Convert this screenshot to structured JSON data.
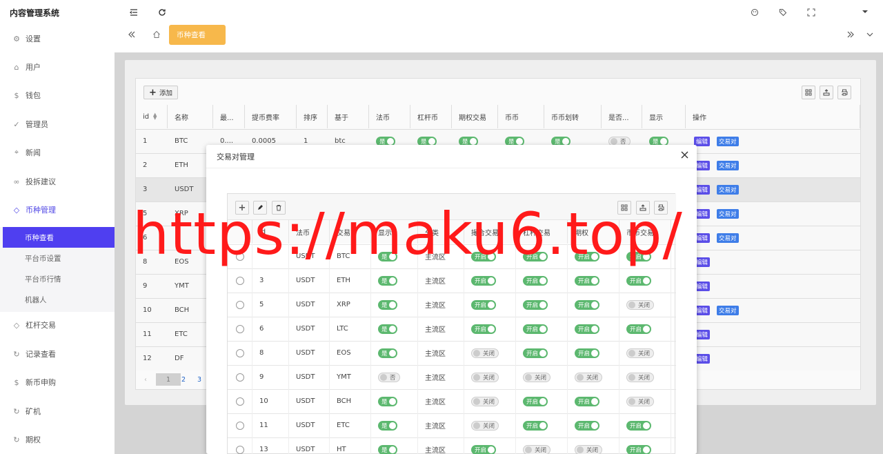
{
  "app": {
    "title": "内容管理系统"
  },
  "sidebar": {
    "items": [
      {
        "label": "设置",
        "icon": "gear-icon"
      },
      {
        "label": "用户",
        "icon": "user-icon"
      },
      {
        "label": "钱包",
        "icon": "coin-icon"
      },
      {
        "label": "管理员",
        "icon": "shield-icon"
      },
      {
        "label": "新闻",
        "icon": "tag-icon"
      },
      {
        "label": "投拆建议",
        "icon": "link-icon"
      },
      {
        "label": "币种管理",
        "icon": "diamond-icon"
      },
      {
        "label": "杠杆交易",
        "icon": "diamond-icon"
      },
      {
        "label": "记录查看",
        "icon": "refresh-icon"
      },
      {
        "label": "新币申购",
        "icon": "coin-icon"
      },
      {
        "label": "矿机",
        "icon": "refresh-icon"
      },
      {
        "label": "期权",
        "icon": "refresh-icon"
      }
    ],
    "submenu": [
      {
        "label": "币种查看"
      },
      {
        "label": "平台币设置"
      },
      {
        "label": "平台币行情"
      },
      {
        "label": "机器人"
      }
    ]
  },
  "tabs": {
    "active": "币种查看"
  },
  "main": {
    "add_label": "添加",
    "columns": [
      "id",
      "名称",
      "最...",
      "提币费率",
      "排序",
      "基于",
      "法币",
      "杠杆币",
      "期权交易",
      "币币",
      "币币划转",
      "是否...",
      "显示",
      "操作"
    ],
    "rows": [
      {
        "id": "1",
        "name": "BTC",
        "min": "0....",
        "fee": "0.0005",
        "sort": "1",
        "base": "btc"
      },
      {
        "id": "2",
        "name": "ETH"
      },
      {
        "id": "3",
        "name": "USDT"
      },
      {
        "id": "5",
        "name": "XRP"
      },
      {
        "id": "6",
        "name": ""
      },
      {
        "id": "8",
        "name": "EOS"
      },
      {
        "id": "9",
        "name": "YMT"
      },
      {
        "id": "10",
        "name": "BCH"
      },
      {
        "id": "11",
        "name": "ETC"
      },
      {
        "id": "12",
        "name": "DF"
      }
    ],
    "row1_toggles": {
      "on": "是",
      "off": "否"
    },
    "actions": {
      "edit": "编辑",
      "pairs": "交易对"
    },
    "pagination": [
      "1",
      "2",
      "3"
    ]
  },
  "modal": {
    "title": "交易对管理",
    "columns": [
      "",
      "id",
      "法币",
      "交易币",
      "显示",
      "分类",
      "撮合交易",
      "杠杆交易",
      "期权",
      "币币交易"
    ],
    "toggle_on_show": "是",
    "toggle_off_show": "否",
    "toggle_on": "开启",
    "toggle_off": "关闭",
    "rows": [
      {
        "id": "",
        "fiat": "USDT",
        "coin": "BTC",
        "show": true,
        "cat": "主流区",
        "match": true,
        "lev": true,
        "opt": true,
        "spot": true
      },
      {
        "id": "3",
        "fiat": "USDT",
        "coin": "ETH",
        "show": true,
        "cat": "主流区",
        "match": true,
        "lev": true,
        "opt": true,
        "spot": true
      },
      {
        "id": "5",
        "fiat": "USDT",
        "coin": "XRP",
        "show": true,
        "cat": "主流区",
        "match": true,
        "lev": true,
        "opt": true,
        "spot": false
      },
      {
        "id": "6",
        "fiat": "USDT",
        "coin": "LTC",
        "show": true,
        "cat": "主流区",
        "match": true,
        "lev": true,
        "opt": true,
        "spot": true
      },
      {
        "id": "8",
        "fiat": "USDT",
        "coin": "EOS",
        "show": true,
        "cat": "主流区",
        "match": false,
        "lev": true,
        "opt": true,
        "spot": false
      },
      {
        "id": "9",
        "fiat": "USDT",
        "coin": "YMT",
        "show": false,
        "cat": "主流区",
        "match": false,
        "lev": false,
        "opt": false,
        "spot": false
      },
      {
        "id": "10",
        "fiat": "USDT",
        "coin": "BCH",
        "show": true,
        "cat": "主流区",
        "match": false,
        "lev": true,
        "opt": true,
        "spot": false
      },
      {
        "id": "11",
        "fiat": "USDT",
        "coin": "ETC",
        "show": true,
        "cat": "主流区",
        "match": false,
        "lev": true,
        "opt": true,
        "spot": true
      },
      {
        "id": "13",
        "fiat": "USDT",
        "coin": "HT",
        "show": true,
        "cat": "主流区",
        "match": true,
        "lev": false,
        "opt": false,
        "spot": true
      }
    ]
  },
  "watermark": {
    "text": "https://maku6.top/"
  },
  "colors": {
    "accent": "#4f3ff0",
    "toggle_on": "#5cb86f",
    "tab_active": "#f7b84b",
    "watermark": "#ff1a1a"
  }
}
